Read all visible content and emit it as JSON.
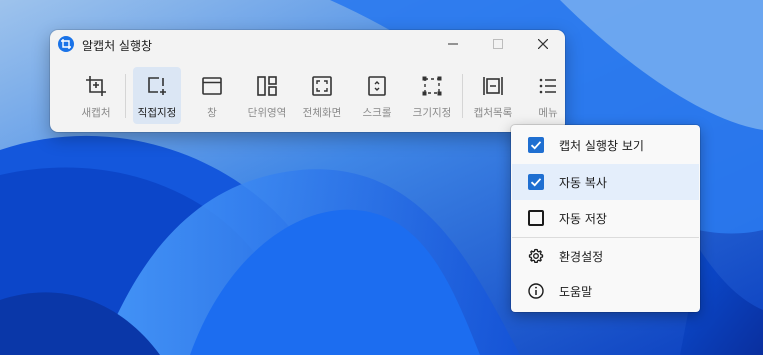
{
  "window": {
    "title": "알캡처 실행창"
  },
  "toolbar": {
    "tools": [
      {
        "label": "새캡처",
        "icon": "new-capture-icon",
        "active": false
      },
      {
        "label": "직접지정",
        "icon": "direct-select-icon",
        "active": true
      },
      {
        "label": "창",
        "icon": "window-capture-icon",
        "active": false
      },
      {
        "label": "단위영역",
        "icon": "unit-area-icon",
        "active": false
      },
      {
        "label": "전체화면",
        "icon": "fullscreen-icon",
        "active": false
      },
      {
        "label": "스크롤",
        "icon": "scroll-capture-icon",
        "active": false
      },
      {
        "label": "크기지정",
        "icon": "size-select-icon",
        "active": false
      },
      {
        "label": "캡처목록",
        "icon": "capture-list-icon",
        "active": false
      },
      {
        "label": "메뉴",
        "icon": "menu-icon",
        "active": false
      }
    ]
  },
  "menu": {
    "items": [
      {
        "label": "캡처 실행창 보기",
        "checked": true
      },
      {
        "label": "자동 복사",
        "checked": true
      },
      {
        "label": "자동 저장",
        "checked": false
      },
      {
        "label": "환경설정",
        "icon": "gear-icon"
      },
      {
        "label": "도움말",
        "icon": "info-icon"
      }
    ]
  },
  "colors": {
    "accent": "#1f6fd1",
    "active_tool_bg": "#dbe6f4",
    "menu_hover_bg": "#e4eefb"
  }
}
